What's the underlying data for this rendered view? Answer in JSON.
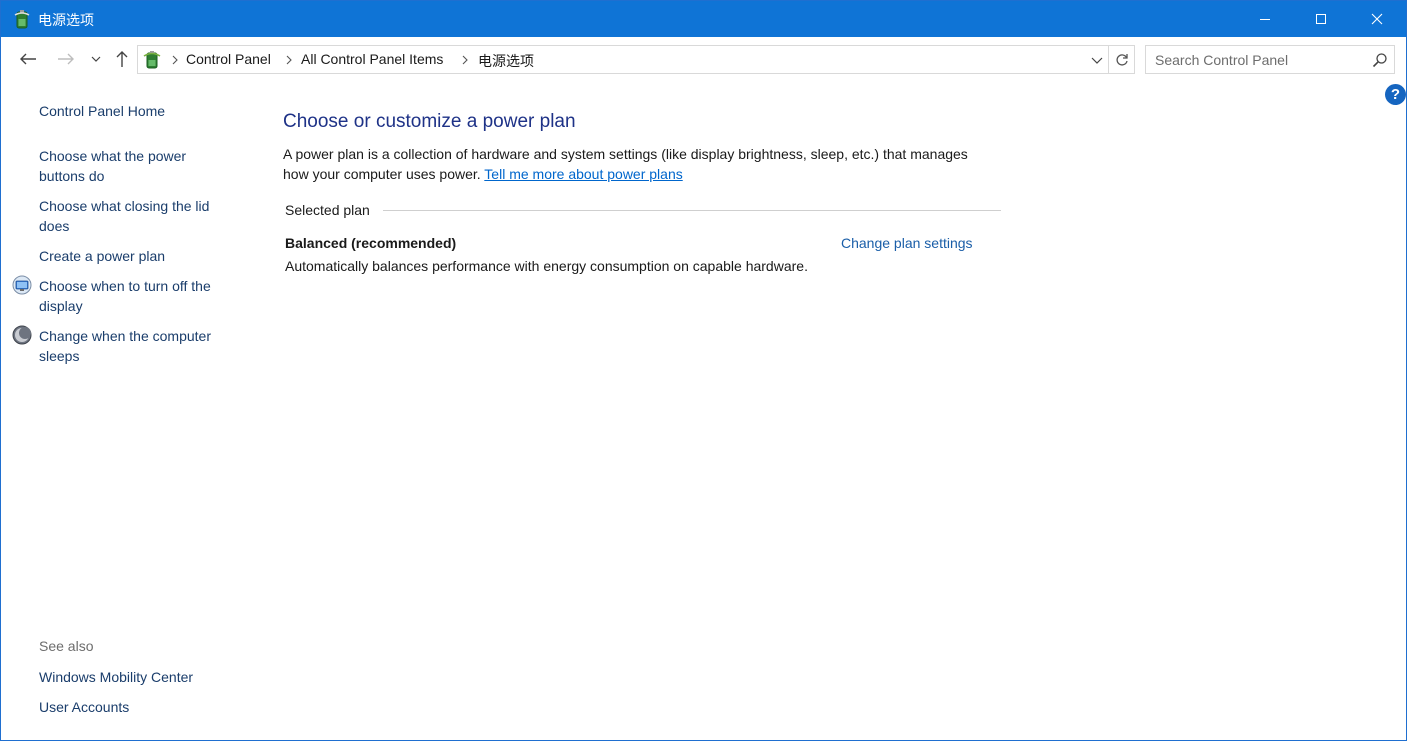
{
  "window": {
    "title": "电源选项"
  },
  "nav": {
    "breadcrumbs": [
      "Control Panel",
      "All Control Panel Items",
      "电源选项"
    ]
  },
  "search": {
    "placeholder": "Search Control Panel"
  },
  "help": {
    "label": "?"
  },
  "sidebar": {
    "home": "Control Panel Home",
    "tasks": [
      {
        "label_line1": "Choose what the power",
        "label_line2": "buttons do"
      },
      {
        "label_line1": "Choose what closing the lid",
        "label_line2": "does"
      },
      {
        "label_line1": "Create a power plan",
        "label_line2": ""
      },
      {
        "label_line1": "Choose when to turn off the",
        "label_line2": "display",
        "icon": "monitor-icon"
      },
      {
        "label_line1": "Change when the computer",
        "label_line2": "sleeps",
        "icon": "moon-icon"
      }
    ],
    "see_also_heading": "See also",
    "see_also": [
      "Windows Mobility Center",
      "User Accounts"
    ]
  },
  "main": {
    "title": "Choose or customize a power plan",
    "description": "A power plan is a collection of hardware and system settings (like display brightness, sleep, etc.) that manages how your computer uses power.",
    "learn_more_link": "Tell me more about power plans",
    "section_label": "Selected plan",
    "plan": {
      "name": "Balanced (recommended)",
      "change_link": "Change plan settings",
      "description": "Automatically balances performance with energy consumption on capable hardware."
    }
  },
  "colors": {
    "titlebar": "#0f74d6",
    "heading": "#1e3287",
    "link": "#0066cc"
  }
}
